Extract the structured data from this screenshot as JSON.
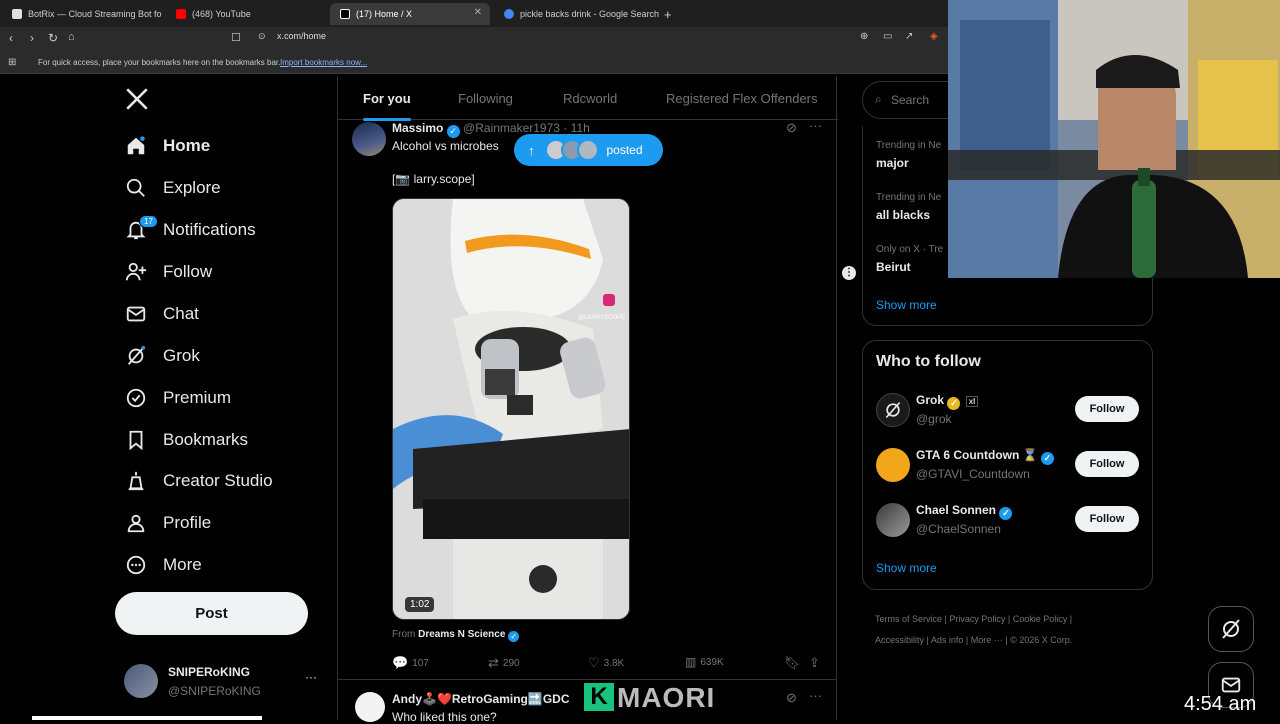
{
  "browser": {
    "tabs": [
      {
        "label": "BotRix — Cloud Streaming Bot fo",
        "color": "#e0e0e0"
      },
      {
        "label": "(468) YouTube",
        "color": "#ff0000"
      },
      {
        "label": "(17) Home / X",
        "color": "#ffffff"
      },
      {
        "label": "pickle backs drink - Google Search",
        "color": "#4285f4"
      }
    ],
    "new_tab": "+",
    "url": "x.com/home",
    "bookmarks_msg": "For quick access, place your bookmarks here on the bookmarks bar.",
    "bookmarks_link": "Import bookmarks now..."
  },
  "nav": {
    "items": [
      {
        "label": "Home",
        "icon": "home-icon"
      },
      {
        "label": "Explore",
        "icon": "search-icon"
      },
      {
        "label": "Notifications",
        "icon": "bell-icon",
        "badge": "17"
      },
      {
        "label": "Follow",
        "icon": "person-plus-icon"
      },
      {
        "label": "Chat",
        "icon": "envelope-icon"
      },
      {
        "label": "Grok",
        "icon": "grok-icon"
      },
      {
        "label": "Premium",
        "icon": "premium-icon"
      },
      {
        "label": "Bookmarks",
        "icon": "bookmark-icon"
      },
      {
        "label": "Creator Studio",
        "icon": "creator-icon"
      },
      {
        "label": "Profile",
        "icon": "profile-icon"
      },
      {
        "label": "More",
        "icon": "more-circle-icon"
      }
    ],
    "post_label": "Post",
    "account": {
      "name": "SNIPERoKING",
      "handle": "@SNIPERoKING",
      "more": "···"
    }
  },
  "feed": {
    "tabs": [
      "For you",
      "Following",
      "Rdcworld",
      "Registered Flex Offenders"
    ],
    "posted_pill": "posted",
    "post": {
      "author": "Massimo",
      "handle": "@Rainmaker1973",
      "time": "· 11h",
      "text": "Alcohol vs microbes",
      "credit": "[📷 larry.scope]",
      "duration": "1:02",
      "from_label": "From",
      "from_source": "Dreams N Science",
      "replies": "107",
      "reposts": "290",
      "likes": "3.8K",
      "views": "639K",
      "watermark": "@LARRYSCOPE"
    },
    "next_post": {
      "author": "Andy🕹️❤️RetroGaming🔜GDC",
      "text": "Who liked this one?"
    }
  },
  "right": {
    "search_placeholder": "Search",
    "trends": [
      {
        "meta": "Trending in Ne",
        "title": "major"
      },
      {
        "meta": "Trending in Ne",
        "title": "all blacks"
      },
      {
        "meta": "Only on X · Tre",
        "title": "Beirut"
      }
    ],
    "trends_show_more": "Show more",
    "who_to_follow_title": "Who to follow",
    "who_to_follow": [
      {
        "name": "Grok",
        "handle": "@grok",
        "extra": "xI"
      },
      {
        "name": "GTA 6 Countdown ⌛",
        "handle": "@GTAVI_Countdown"
      },
      {
        "name": "Chael Sonnen",
        "handle": "@ChaelSonnen"
      }
    ],
    "follow_label": "Follow",
    "wtf_show_more": "Show more",
    "footer": [
      "Terms of Service",
      "Privacy Policy",
      "Cookie Policy",
      "Accessibility",
      "Ads info",
      "More ···",
      "© 2026 X Corp."
    ]
  },
  "overlay": {
    "clock": "4:54 am",
    "brand": "MAORI",
    "brand_badge": "K"
  },
  "colors": {
    "accent": "#1d9bf0",
    "gold": "#e8b923"
  }
}
